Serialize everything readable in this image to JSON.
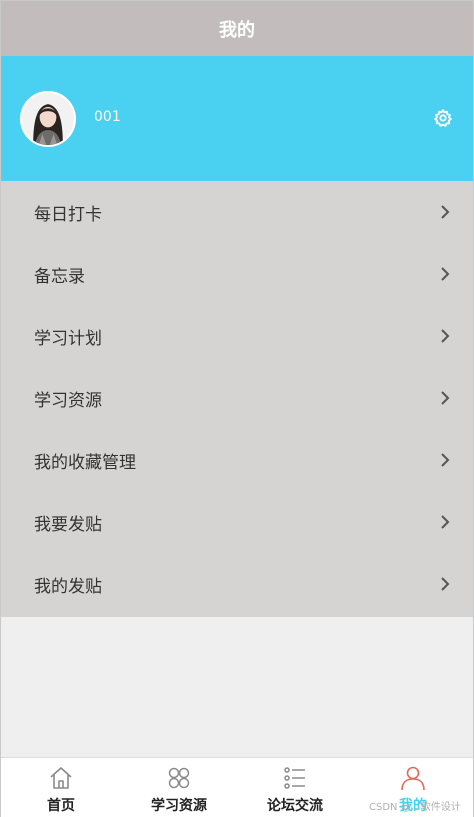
{
  "header": {
    "title": "我的"
  },
  "profile": {
    "username": "001"
  },
  "menu": {
    "items": [
      {
        "label": "每日打卡"
      },
      {
        "label": "备忘录"
      },
      {
        "label": "学习计划"
      },
      {
        "label": "学习资源"
      },
      {
        "label": "我的收藏管理"
      },
      {
        "label": "我要发贴"
      },
      {
        "label": "我的发贴"
      }
    ]
  },
  "tabbar": {
    "tabs": [
      {
        "label": "首页",
        "icon": "home-icon"
      },
      {
        "label": "学习资源",
        "icon": "grid-icon"
      },
      {
        "label": "论坛交流",
        "icon": "list-icon"
      },
      {
        "label": "我的",
        "icon": "user-icon",
        "active": true
      }
    ]
  },
  "watermark": "CSDN @…软件设计",
  "colors": {
    "header_bg": "#c2bdbc",
    "profile_bg": "#4ad0f0",
    "menu_bg": "#d5d4d3",
    "active_tab": "#4ad0f0",
    "user_icon": "#e06a5a"
  }
}
